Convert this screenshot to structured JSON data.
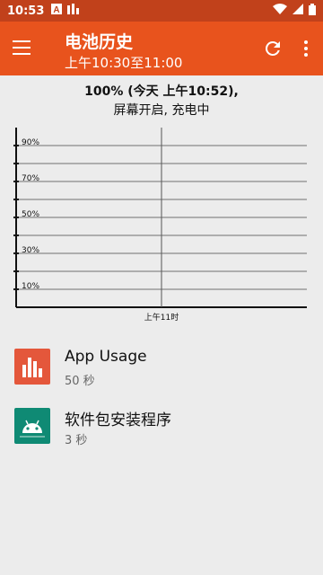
{
  "status": {
    "time": "10:53"
  },
  "appbar": {
    "title": "电池历史",
    "subtitle": "上午10:30至11:00"
  },
  "summary": {
    "line1": "100% (今天 上午10:52),",
    "line2": "屏幕开启, 充电中"
  },
  "chart_data": {
    "type": "line",
    "y_tick_labels": [
      "90%",
      "70%",
      "50%",
      "30%",
      "10%"
    ],
    "x_tick_labels": [
      "上午11时"
    ],
    "ylim": [
      0,
      100
    ],
    "grid": true
  },
  "apps": [
    {
      "name": "App Usage",
      "duration": "50 秒",
      "icon": "app-usage-icon",
      "color": "#e4573b"
    },
    {
      "name": "软件包安装程序",
      "duration": "3 秒",
      "icon": "android-icon",
      "color": "#0f8a74"
    }
  ]
}
